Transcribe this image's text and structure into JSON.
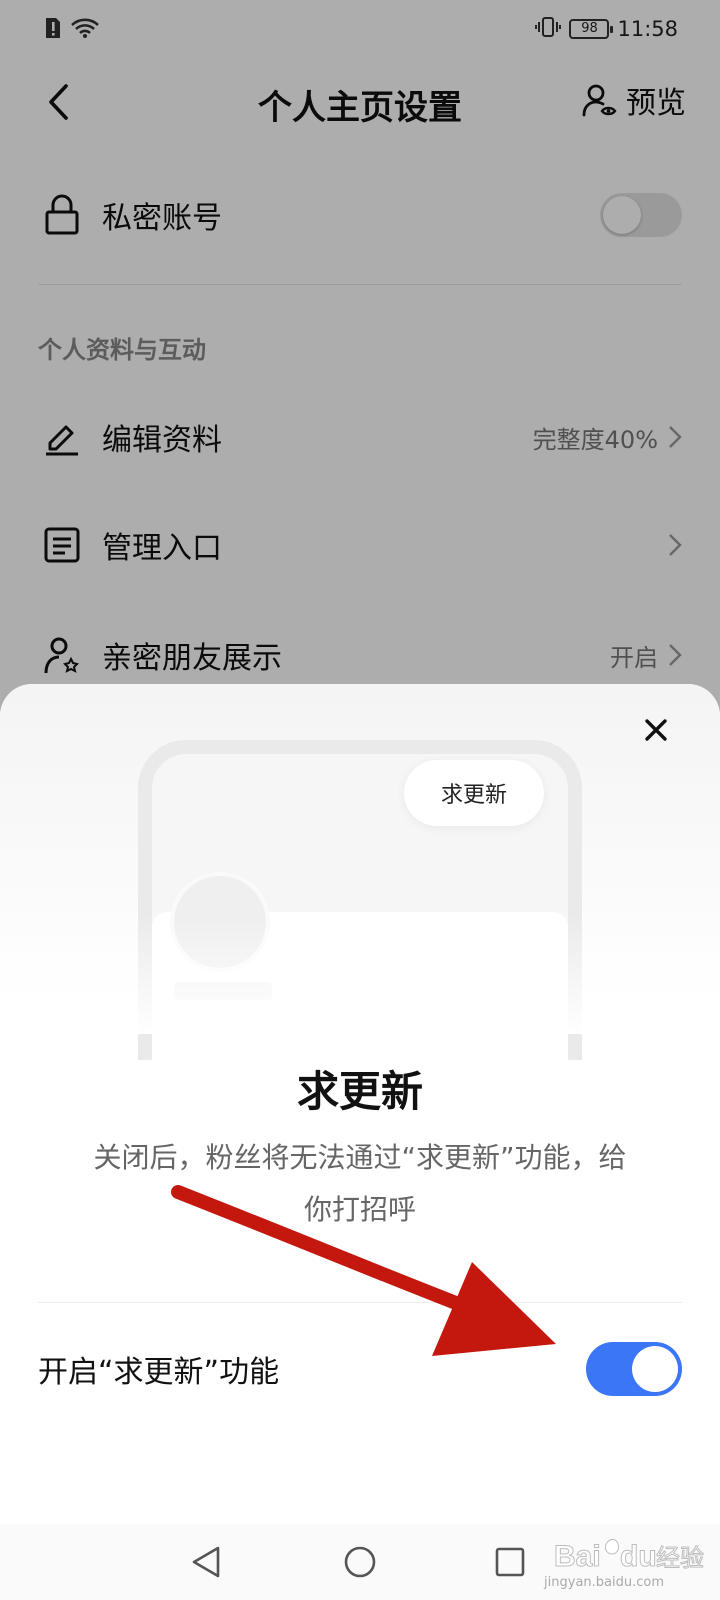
{
  "status_bar": {
    "time": "11:58",
    "battery": "98"
  },
  "nav": {
    "title": "个人主页设置",
    "preview_label": "预览"
  },
  "settings": {
    "private_account": {
      "label": "私密账号",
      "enabled": false
    },
    "section_title": "个人资料与互动",
    "items": [
      {
        "label": "编辑资料",
        "value": "完整度40%",
        "icon": "edit-icon"
      },
      {
        "label": "管理入口",
        "value": "",
        "icon": "list-icon"
      },
      {
        "label": "亲密朋友展示",
        "value": "开启",
        "icon": "friends-icon"
      }
    ]
  },
  "sheet": {
    "illustration_button": "求更新",
    "title": "求更新",
    "description": "关闭后，粉丝将无法通过“求更新”功能，给你打招呼",
    "feature_label": "开启“求更新”功能",
    "feature_enabled": true
  },
  "watermark": {
    "text": "jingyan.baidu.com"
  },
  "colors": {
    "accent": "#3b76f6",
    "arrow": "#c4180f"
  }
}
